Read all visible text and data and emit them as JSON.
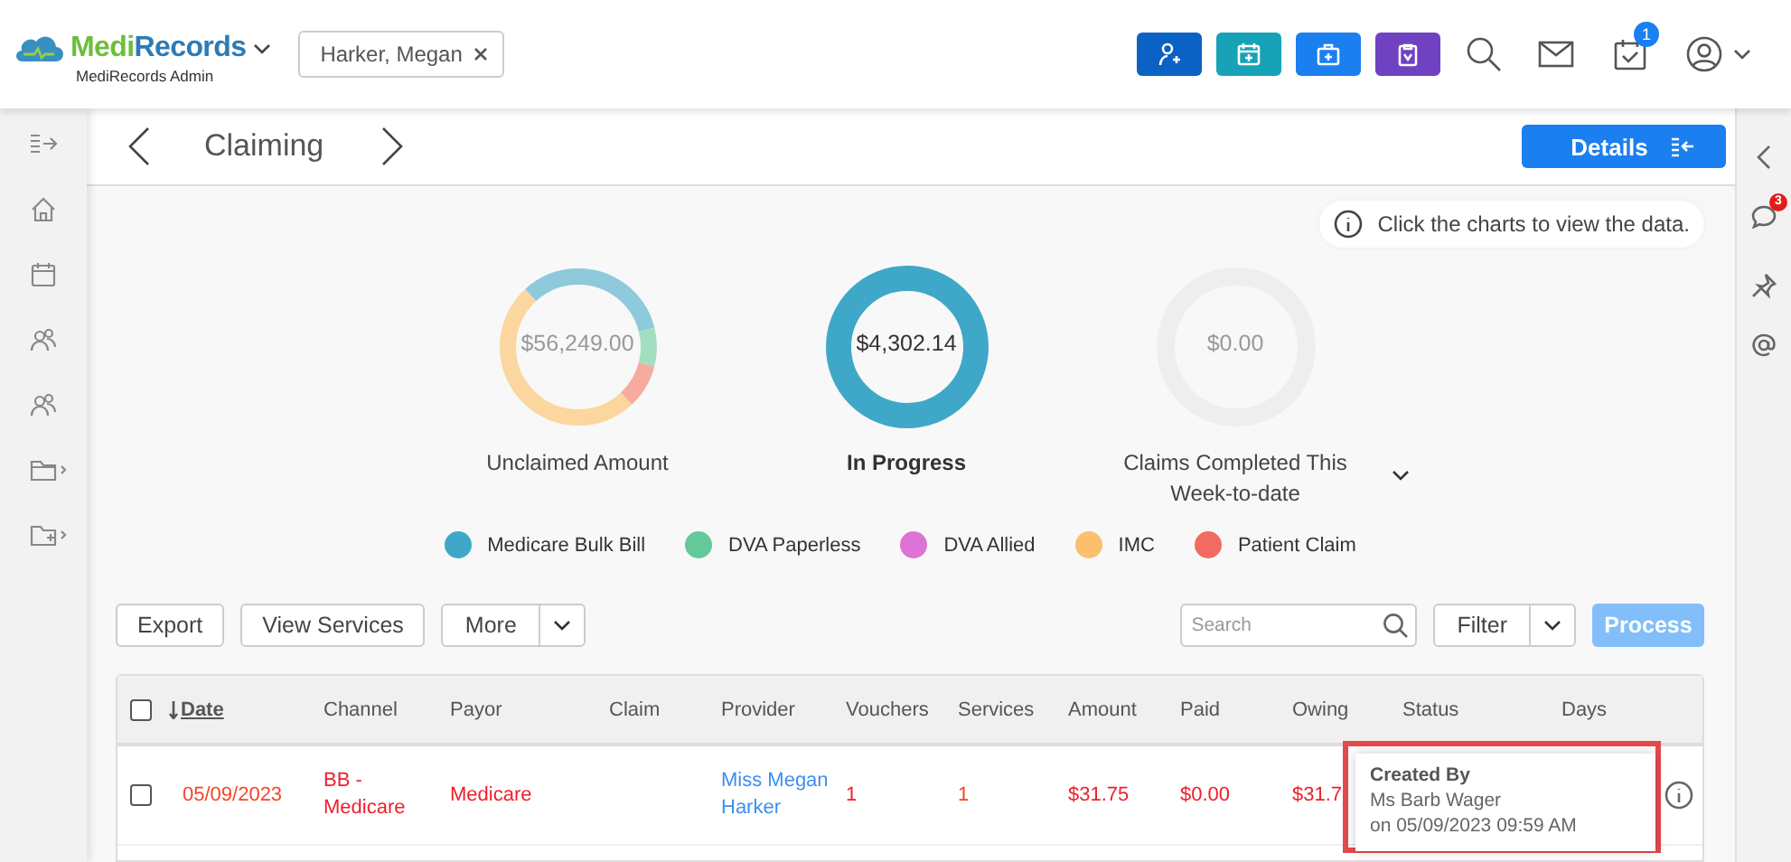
{
  "app": {
    "brand": "MediRecords",
    "brand_subtitle": "MediRecords Admin",
    "patient_chip": "Harker, Megan",
    "notification_count": "1"
  },
  "right_rail": {
    "chat_badge": "3"
  },
  "page": {
    "title": "Claiming",
    "details_button": "Details",
    "hint": "Click the charts to view the data."
  },
  "summary_charts": [
    {
      "kind": "segmented",
      "value": "$56,249.00",
      "label": "Unclaimed Amount",
      "selected": false,
      "dropdown": false
    },
    {
      "kind": "solid",
      "value": "$4,302.14",
      "label": "In Progress",
      "selected": true,
      "dropdown": false
    },
    {
      "kind": "empty",
      "value": "$0.00",
      "label": "Claims Completed This Week-to-date",
      "selected": false,
      "dropdown": true
    }
  ],
  "legend": [
    {
      "label": "Medicare Bulk Bill",
      "color": "#3fa8c8"
    },
    {
      "label": "DVA Paperless",
      "color": "#63c99a"
    },
    {
      "label": "DVA Allied",
      "color": "#dd72d7"
    },
    {
      "label": "IMC",
      "color": "#fcbf6e"
    },
    {
      "label": "Patient Claim",
      "color": "#f26b62"
    }
  ],
  "toolbar": {
    "buttons": [
      "Export",
      "View Services"
    ],
    "more_button": "More",
    "search": {
      "placeholder": "Search"
    },
    "filter_button": "Filter",
    "process_button": {
      "label": "Process",
      "disabled": true
    }
  },
  "table": {
    "select_all": {
      "checked": false
    },
    "columns": [
      {
        "label": "Date",
        "sorted": true
      },
      {
        "label": "Channel",
        "sorted": false
      },
      {
        "label": "Payor",
        "sorted": false
      },
      {
        "label": "Claim",
        "sorted": false
      },
      {
        "label": "Provider",
        "sorted": false
      },
      {
        "label": "Vouchers",
        "sorted": false
      },
      {
        "label": "Services",
        "sorted": false
      },
      {
        "label": "Amount",
        "sorted": false
      },
      {
        "label": "Paid",
        "sorted": false
      },
      {
        "label": "Owing",
        "sorted": false
      },
      {
        "label": "Status",
        "sorted": false
      },
      {
        "label": "Days",
        "sorted": false
      }
    ],
    "rows": [
      {
        "checked": false,
        "date": "05/09/2023",
        "channel": "BB - Medicare",
        "payor": "Medicare",
        "provider": "Miss Megan Harker",
        "vouchers": "1",
        "services": "1",
        "amount": "$31.75",
        "paid": "$0.00",
        "owing": "$31.7"
      }
    ]
  },
  "tooltip": {
    "title": "Created By",
    "lines": [
      "Ms Barb Wager",
      "on 05/09/2023 09:59 AM"
    ]
  }
}
